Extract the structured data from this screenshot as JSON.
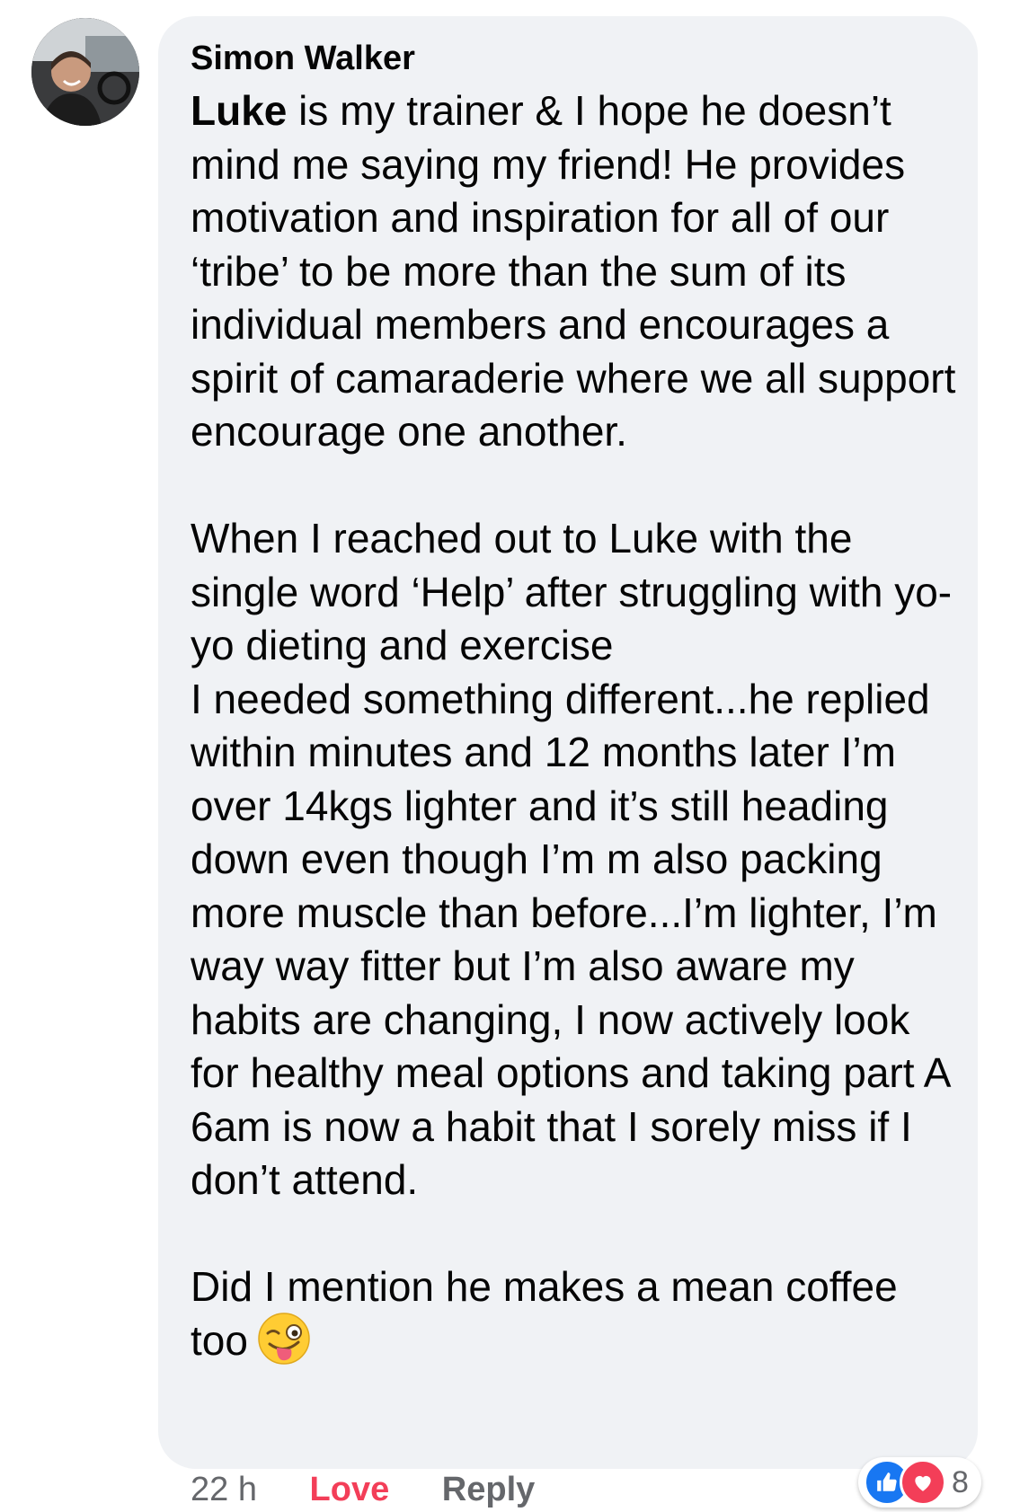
{
  "comment": {
    "author": "Simon Walker",
    "mention": "Luke",
    "paragraph_1_rest": " is my trainer & I hope he doesn’t mind me saying my friend! He provides motivation and inspiration for all of our ‘tribe’ to be more than the sum of its individual members and encourages a spirit of camaraderie where we all support encourage one another.",
    "paragraph_2": "When I reached out to Luke with the single word ‘Help’ after struggling with yo-yo dieting and exercise\nI needed something different...he replied within minutes and 12 months later I’m over 14kgs lighter and it’s still heading down even though I’m m also packing more muscle than before...I’m lighter, I’m way way fitter but I’m also aware my habits are changing, I now actively look for healthy meal options and taking part A 6am is now a habit that I sorely miss if I don’t attend.",
    "paragraph_3": "Did I mention he makes a mean coffee too",
    "emoji": "winking-face-with-tongue-emoji"
  },
  "actions": {
    "time": "22 h",
    "love_label": "Love",
    "reply_label": "Reply"
  },
  "reactions": {
    "icons": [
      "like-icon",
      "love-icon"
    ],
    "count": "8",
    "colors": {
      "like": "#1877f2",
      "love": "#f33e58"
    }
  }
}
